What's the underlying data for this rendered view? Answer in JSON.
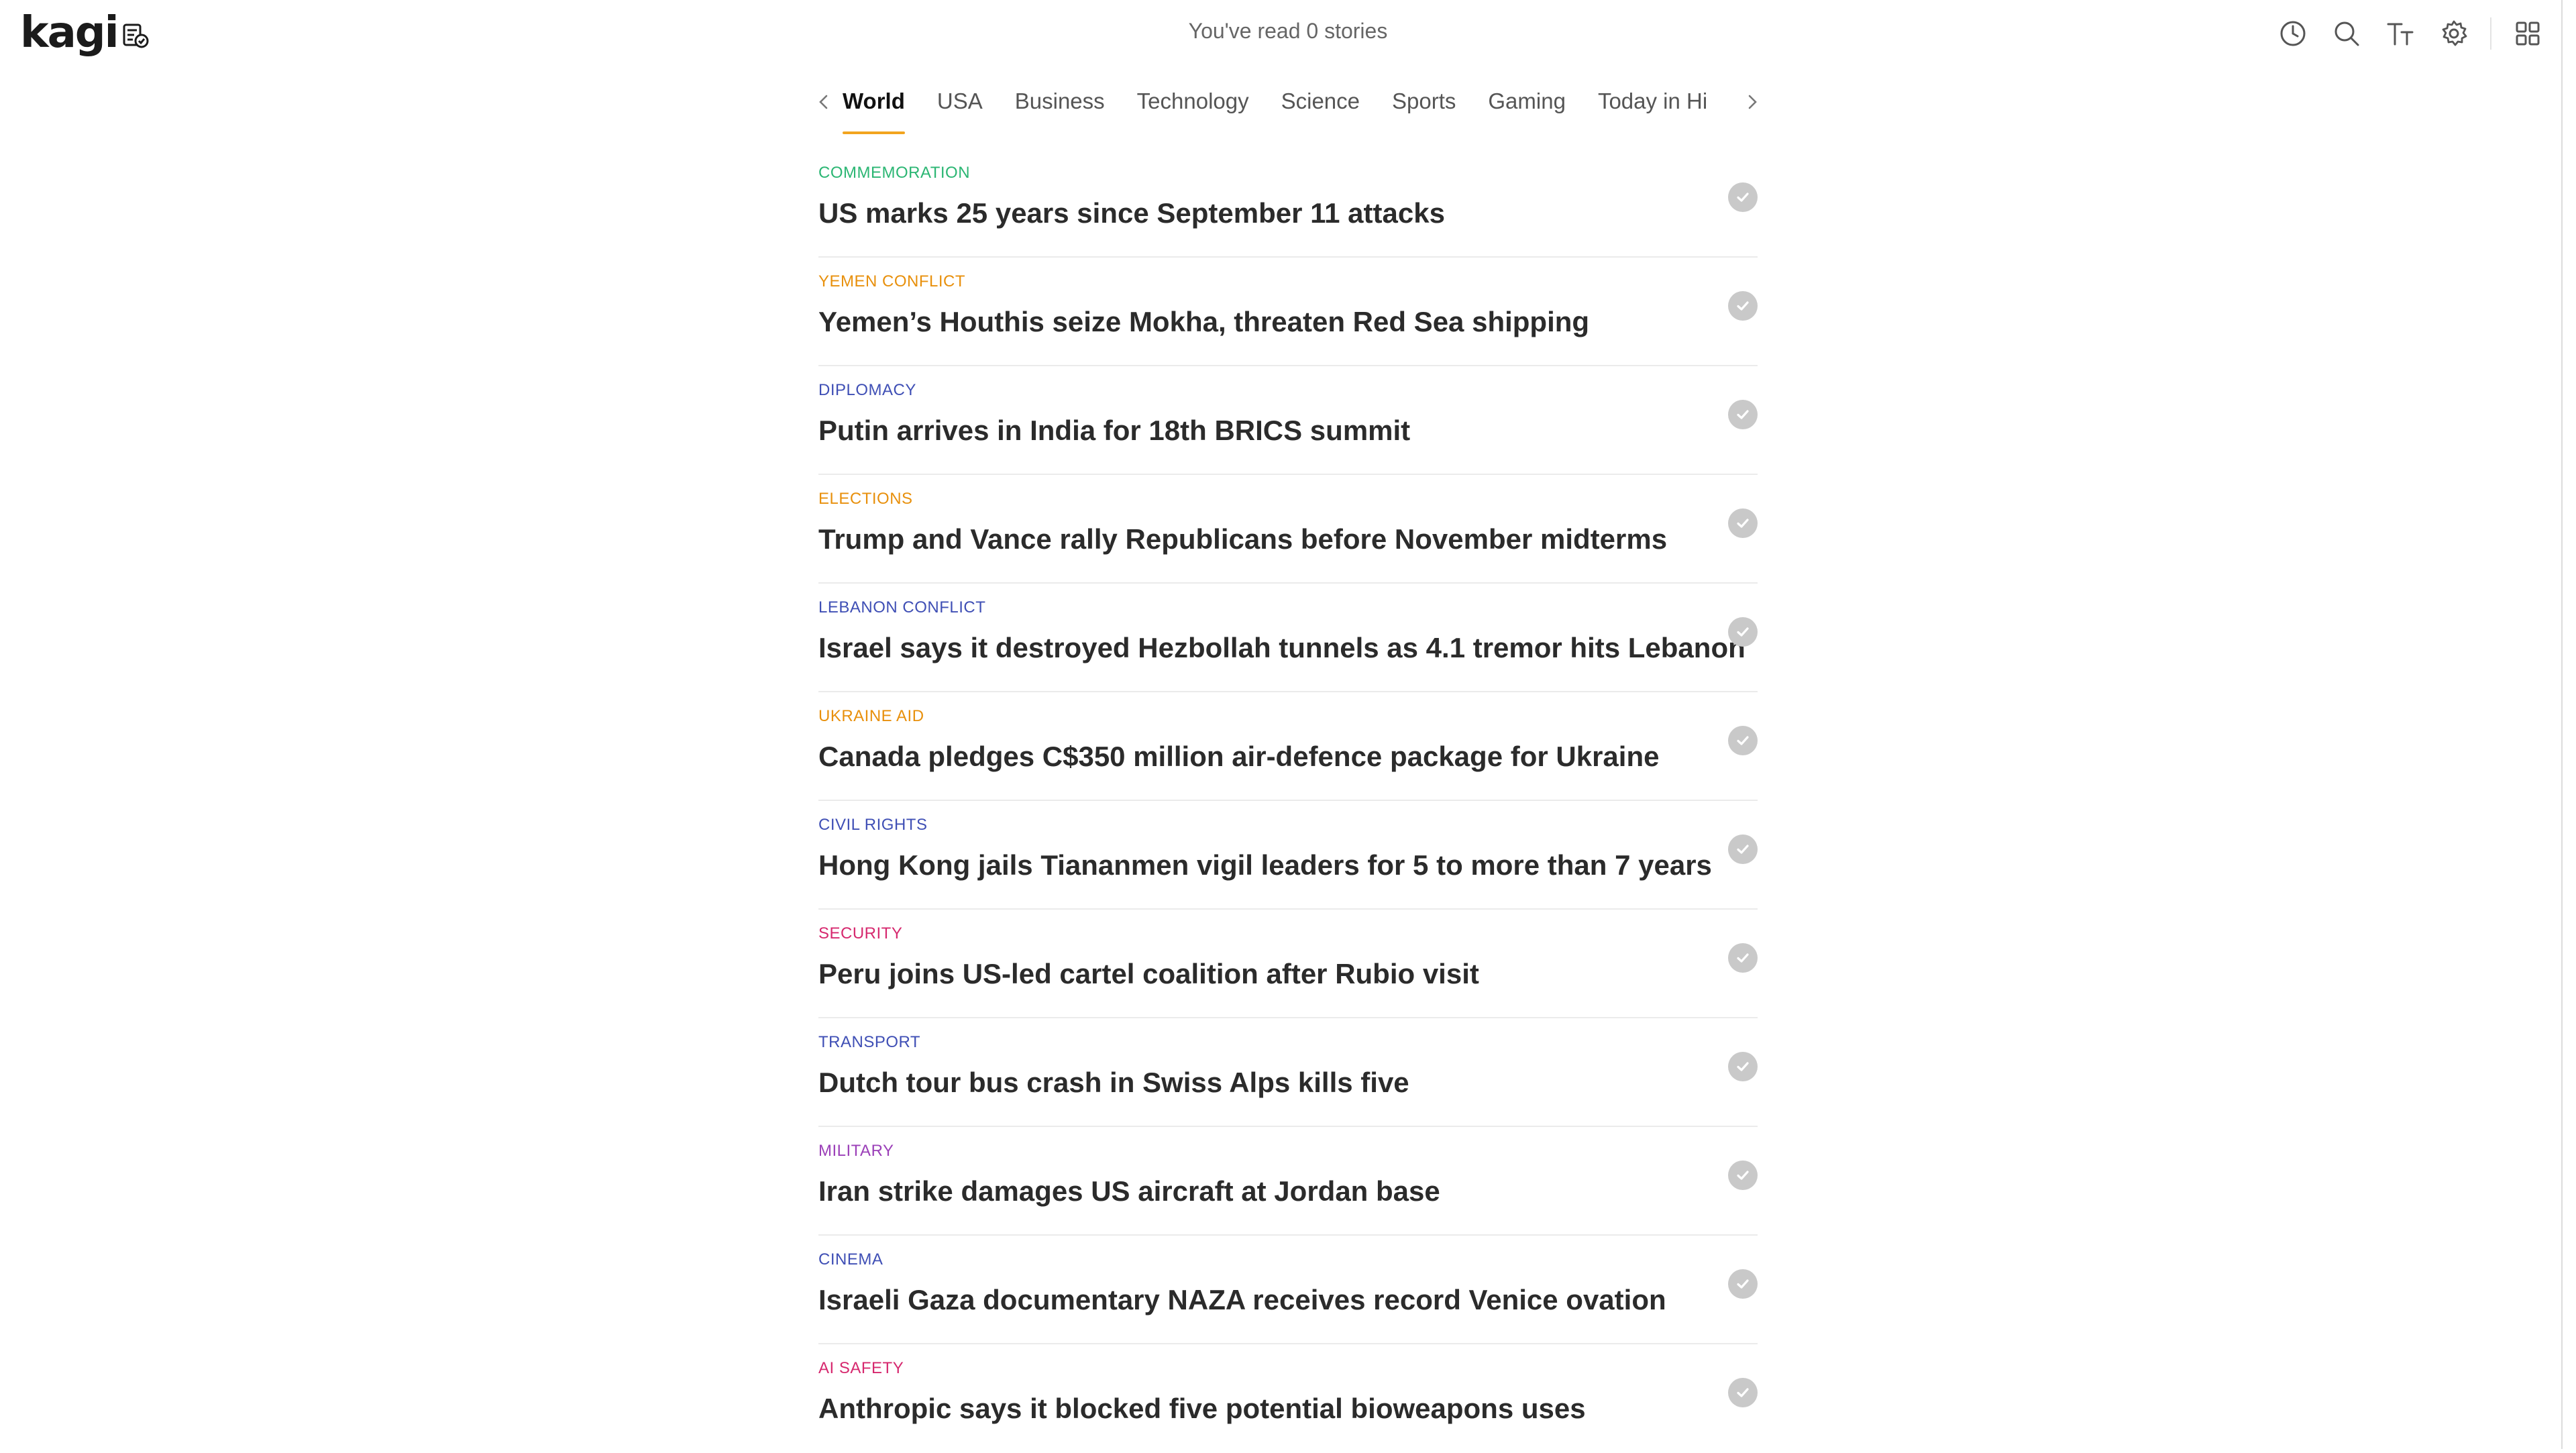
{
  "app": {
    "logo_text": "kagi",
    "read_counter": "You've read 0 stories"
  },
  "toolbar": {
    "icons": [
      "history-icon",
      "search-icon",
      "text-size-icon",
      "settings-icon",
      "apps-grid-icon"
    ]
  },
  "tabs": {
    "items": [
      {
        "label": "World",
        "active": true
      },
      {
        "label": "USA",
        "active": false
      },
      {
        "label": "Business",
        "active": false
      },
      {
        "label": "Technology",
        "active": false
      },
      {
        "label": "Science",
        "active": false
      },
      {
        "label": "Sports",
        "active": false
      },
      {
        "label": "Gaming",
        "active": false
      },
      {
        "label": "Today in Hi",
        "active": false
      }
    ],
    "accent_color": "#f2a41f"
  },
  "stories": [
    {
      "category": "COMMEMORATION",
      "category_color": "#2bb673",
      "title": "US marks 25 years since September 11 attacks"
    },
    {
      "category": "YEMEN CONFLICT",
      "category_color": "#e8900c",
      "title": "Yemen’s Houthis seize Mokha, threaten Red Sea shipping"
    },
    {
      "category": "DIPLOMACY",
      "category_color": "#3f4fb5",
      "title": "Putin arrives in India for 18th BRICS summit"
    },
    {
      "category": "ELECTIONS",
      "category_color": "#e8900c",
      "title": "Trump and Vance rally Republicans before November midterms"
    },
    {
      "category": "LEBANON CONFLICT",
      "category_color": "#3f4fb5",
      "title": "Israel says it destroyed Hezbollah tunnels as 4.1 tremor hits Lebanon"
    },
    {
      "category": "UKRAINE AID",
      "category_color": "#e8900c",
      "title": "Canada pledges C$350 million air-defence package for Ukraine"
    },
    {
      "category": "CIVIL RIGHTS",
      "category_color": "#3f4fb5",
      "title": "Hong Kong jails Tiananmen vigil leaders for 5 to more than 7 years"
    },
    {
      "category": "SECURITY",
      "category_color": "#d6286e",
      "title": "Peru joins US-led cartel coalition after Rubio visit"
    },
    {
      "category": "TRANSPORT",
      "category_color": "#3f4fb5",
      "title": "Dutch tour bus crash in Swiss Alps kills five"
    },
    {
      "category": "MILITARY",
      "category_color": "#9b3fb8",
      "title": "Iran strike damages US aircraft at Jordan base"
    },
    {
      "category": "CINEMA",
      "category_color": "#3f4fb5",
      "title": "Israeli Gaza documentary NAZA receives record Venice ovation"
    },
    {
      "category": "AI SAFETY",
      "category_color": "#d6286e",
      "title": "Anthropic says it blocked five potential bioweapons uses"
    }
  ]
}
